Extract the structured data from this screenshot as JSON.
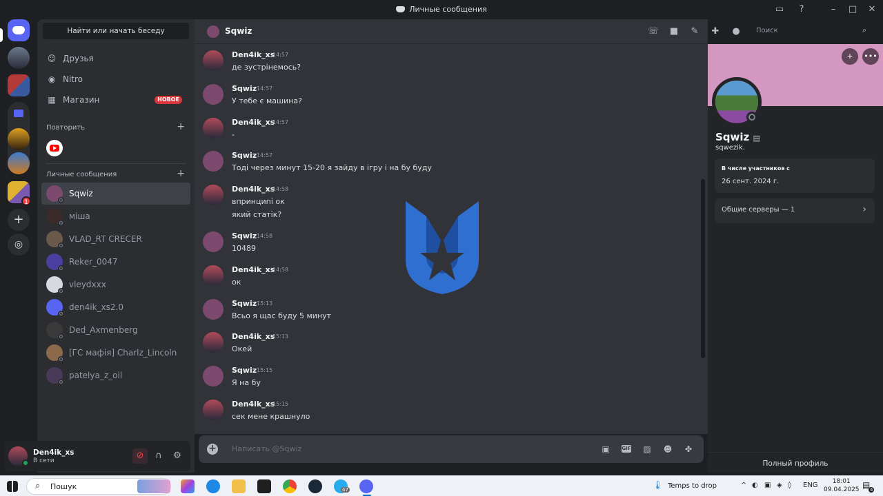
{
  "window": {
    "title": "Личные сообщения"
  },
  "sidebar": {
    "search_button": "Найти или начать беседу",
    "nav": [
      {
        "label": "Друзья",
        "icon": "friends-icon"
      },
      {
        "label": "Nitro",
        "icon": "nitro-icon"
      },
      {
        "label": "Магазин",
        "icon": "shop-icon",
        "badge": "НОВОЕ"
      }
    ],
    "recent_header": "Повторить",
    "dm_header": "Личные сообщения",
    "dms": [
      {
        "name": "Sqwiz",
        "color": "#7b4a6e",
        "active": true
      },
      {
        "name": "міша",
        "color": "#3a2a2a"
      },
      {
        "name": "VLAD_RT CRECER",
        "color": "#6b5a4a"
      },
      {
        "name": "Reker_0047",
        "color": "#4a3fa0"
      },
      {
        "name": "vleydxxx",
        "color": "#d8d8e0"
      },
      {
        "name": "den4ik_xs2.0",
        "color": "#5865f2"
      },
      {
        "name": "Ded_Axmenberg",
        "color": "#3a3a3a"
      },
      {
        "name": "[ГС мафія] Charlz_Lincoln",
        "color": "#8a6a4a"
      },
      {
        "name": "patelya_z_oil",
        "color": "#4a3a5a"
      }
    ]
  },
  "user_panel": {
    "name": "Den4ik_xs",
    "status": "В сети"
  },
  "guilds": {
    "badge_count": "1"
  },
  "chat": {
    "recipient": "Sqwiz",
    "search_placeholder": "Поиск",
    "composer_placeholder": "Написать @Sqwiz",
    "messages": [
      {
        "author": "Den4ik_xs",
        "time": "14:57",
        "lines": [
          "де зустрінемось?"
        ]
      },
      {
        "author": "Sqwiz",
        "time": "14:57",
        "lines": [
          "У тебе є машина?"
        ]
      },
      {
        "author": "Den4ik_xs",
        "time": "14:57",
        "lines": [
          "-"
        ]
      },
      {
        "author": "Sqwiz",
        "time": "14:57",
        "lines": [
          "Тоді через минут 15-20 я зайду в ігру і на бу буду"
        ]
      },
      {
        "author": "Den4ik_xs",
        "time": "14:58",
        "lines": [
          "впринципі ок",
          "який статік?"
        ]
      },
      {
        "author": "Sqwiz",
        "time": "14:58",
        "lines": [
          "10489"
        ]
      },
      {
        "author": "Den4ik_xs",
        "time": "14:58",
        "lines": [
          "ок"
        ]
      },
      {
        "author": "Sqwiz",
        "time": "15:13",
        "lines": [
          "Всьо я щас буду 5 минут"
        ]
      },
      {
        "author": "Den4ik_xs",
        "time": "15:13",
        "lines": [
          "Окей"
        ]
      },
      {
        "author": "Sqwiz",
        "time": "15:15",
        "lines": [
          "Я на бу"
        ]
      },
      {
        "author": "Den4ik_xs",
        "time": "15:15",
        "lines": [
          "сек мене крашнуло"
        ]
      }
    ]
  },
  "profile": {
    "display_name": "Sqwiz",
    "username": "sqwezik.",
    "member_since_label": "В числе участников с",
    "member_since": "26 сент. 2024 г.",
    "mutual_servers": "Общие серверы — 1",
    "full_profile": "Полный профиль",
    "banner_color": "#d497c0"
  },
  "taskbar": {
    "search": "Пошук",
    "weather": "Temps to drop",
    "lang": "ENG",
    "time": "18:01",
    "date": "09.04.2025",
    "telegram_badge": "47",
    "notif_count": "4"
  },
  "colors": {
    "accent": "#5865f2",
    "online": "#23a55a",
    "danger": "#da373c"
  }
}
